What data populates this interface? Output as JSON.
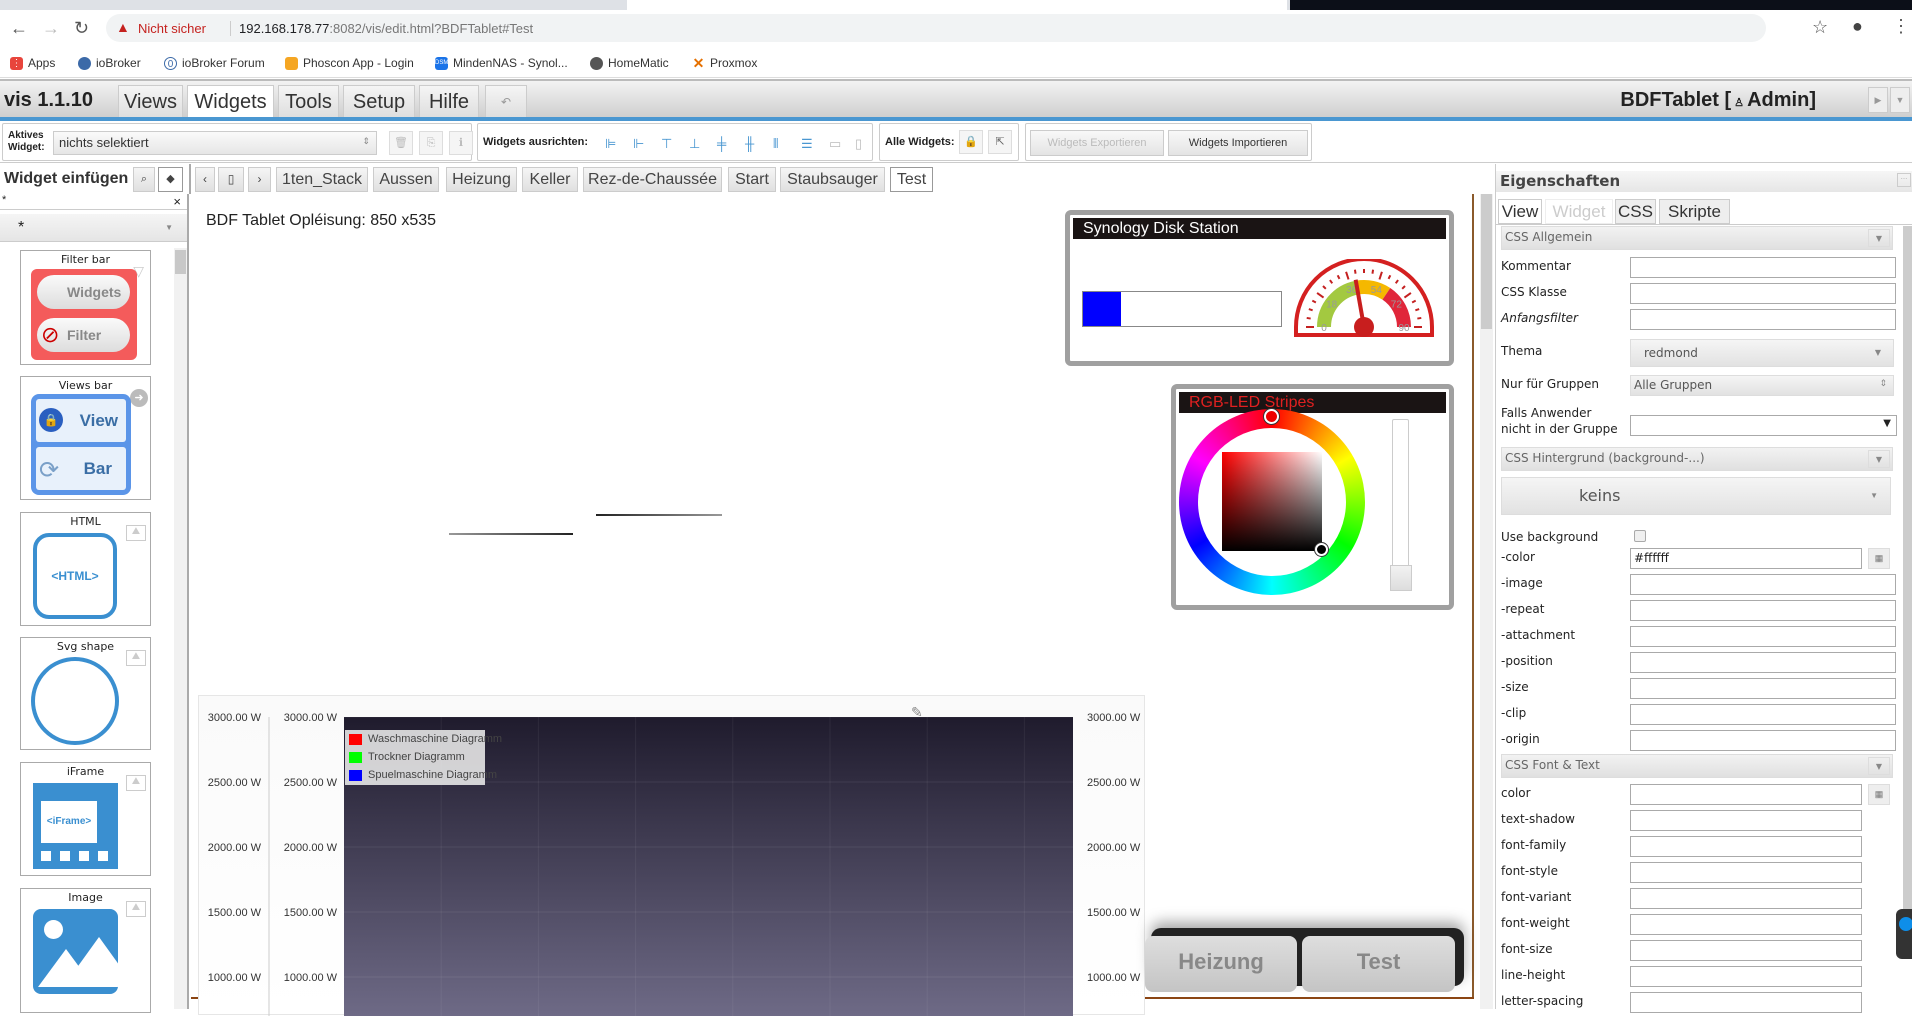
{
  "browser": {
    "security_warning": "Nicht sicher",
    "url_host": "192.168.178.77",
    "url_rest": ":8082/vis/edit.html?BDFTablet#Test",
    "bookmarks": [
      {
        "label": "Apps",
        "icon": "apps-grid-icon"
      },
      {
        "label": "ioBroker",
        "icon": "iobroker-icon"
      },
      {
        "label": "ioBroker Forum",
        "icon": "iobroker-forum-icon"
      },
      {
        "label": "Phoscon App - Login",
        "icon": "phoscon-icon"
      },
      {
        "label": "MindenNAS - Synol...",
        "icon": "dsm-icon"
      },
      {
        "label": "HomeMatic",
        "icon": "globe-icon"
      },
      {
        "label": "Proxmox",
        "icon": "proxmox-icon"
      }
    ]
  },
  "menubar": {
    "app_title": "vis 1.1.10",
    "tabs": [
      "Views",
      "Widgets",
      "Tools",
      "Setup",
      "Hilfe"
    ],
    "active_tab": "Widgets",
    "undo": "↶",
    "project_title": "BDFTablet [",
    "user": "Admin]"
  },
  "toolbar": {
    "active_widget_label": "Aktives Widget:",
    "active_widget_value": "nichts selektiert",
    "align_label": "Widgets ausrichten:",
    "all_widgets_label": "Alle Widgets:",
    "export_label": "Widgets Exportieren",
    "import_label": "Widgets Importieren"
  },
  "widget_panel": {
    "title": "Widget einfügen",
    "search_value": "*",
    "filter_value": "*",
    "widgets": [
      "Filter bar",
      "Views bar",
      "HTML",
      "Svg shape",
      "iFrame",
      "Image"
    ],
    "filter_bar_preview": [
      "Widgets",
      "Filter"
    ],
    "views_bar_preview": [
      "View",
      "Bar"
    ],
    "html_preview": "<HTML>",
    "iframe_preview": "<iFrame>"
  },
  "view_tabs": [
    "1ten_Stack",
    "Aussen",
    "Heizung",
    "Keller",
    "Rez-de-Chaussée",
    "Start",
    "Staubsauger",
    "Test"
  ],
  "active_view": "Test",
  "canvas": {
    "info_text": "BDF Tablet Opléisung: 850 x535",
    "synology": {
      "title": "Synology Disk Station",
      "progress_percent": 19,
      "progress_color": "#0000ff",
      "gauge": {
        "min": 0,
        "max": 90,
        "ticks": [
          "0",
          "18",
          "36",
          "54",
          "72",
          "90"
        ],
        "value": 40
      }
    },
    "rgb": {
      "title": "RGB-LED Stripes",
      "selected_color": "#ff0000"
    },
    "nav_buttons": [
      "Heizung",
      "Test"
    ]
  },
  "chart_data": {
    "type": "line",
    "y_ticks": [
      "3000.00 W",
      "2500.00 W",
      "2000.00 W",
      "1500.00 W",
      "1000.00 W"
    ],
    "ylim": [
      950,
      3000
    ],
    "grid": true,
    "legend_placement": "top-left",
    "series": [
      {
        "name": "Waschmaschine Diagramm",
        "color": "#ff0000",
        "values": []
      },
      {
        "name": "Trockner Diagramm",
        "color": "#00ff00",
        "values": []
      },
      {
        "name": "Spuelmaschine Diagramm",
        "color": "#0000ff",
        "values": []
      }
    ]
  },
  "properties": {
    "title": "Eigenschaften",
    "tabs": [
      "View",
      "Widget",
      "CSS",
      "Skripte"
    ],
    "sections": {
      "general": "CSS Allgemein",
      "background": "CSS Hintergrund (background-...)",
      "font": "CSS Font & Text"
    },
    "general_rows": [
      {
        "label": "Kommentar",
        "value": ""
      },
      {
        "label": "CSS Klasse",
        "value": ""
      },
      {
        "label": "Anfangsfilter",
        "value": ""
      }
    ],
    "thema_label": "Thema",
    "thema_value": "redmond",
    "groups_label": "Nur für Gruppen",
    "groups_value": "Alle Gruppen",
    "fallback_label": "Falls Anwender nicht in der Gruppe",
    "fallback_value": "",
    "background_type": "keins",
    "use_background_label": "Use background",
    "use_background": false,
    "bg_rows": [
      {
        "label": "-color",
        "value": "#ffffff"
      },
      {
        "label": "-image",
        "value": ""
      },
      {
        "label": "-repeat",
        "value": ""
      },
      {
        "label": "-attachment",
        "value": ""
      },
      {
        "label": "-position",
        "value": ""
      },
      {
        "label": "-size",
        "value": ""
      },
      {
        "label": "-clip",
        "value": ""
      },
      {
        "label": "-origin",
        "value": ""
      }
    ],
    "font_rows": [
      {
        "label": "color",
        "value": ""
      },
      {
        "label": "text-shadow",
        "value": ""
      },
      {
        "label": "font-family",
        "value": ""
      },
      {
        "label": "font-style",
        "value": ""
      },
      {
        "label": "font-variant",
        "value": ""
      },
      {
        "label": "font-weight",
        "value": ""
      },
      {
        "label": "font-size",
        "value": ""
      },
      {
        "label": "line-height",
        "value": ""
      },
      {
        "label": "letter-spacing",
        "value": ""
      }
    ]
  }
}
